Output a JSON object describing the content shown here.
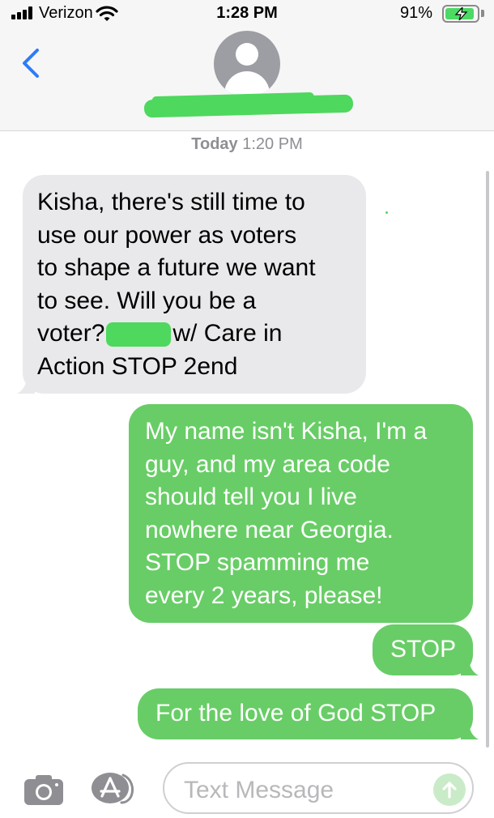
{
  "status_bar": {
    "carrier": "Verizon",
    "time": "1:28 PM",
    "battery_percent": "91%",
    "battery_level": 0.91,
    "signal_icon": "signal-bars-icon",
    "wifi_icon": "wifi-icon",
    "battery_icon": "battery-charging-icon"
  },
  "header": {
    "back_icon": "chevron-left-icon",
    "avatar_icon": "person-silhouette-icon",
    "contact_name_redacted": true
  },
  "thread": {
    "timestamp_day": "Today",
    "timestamp_time": "1:20 PM",
    "messages": [
      {
        "direction": "incoming",
        "lines": [
          "Kisha, there's still time to",
          "use our power as voters",
          "to shape a future we want",
          "to see. Will you be a"
        ],
        "line5_before": "voter?",
        "line5_after": "w/ Care in",
        "line6": "Action STOP 2end"
      },
      {
        "direction": "outgoing",
        "lines": [
          "My name isn't Kisha, I'm a",
          "guy, and my area code",
          "should tell you I live",
          "nowhere near Georgia.",
          "STOP spamming me",
          "every 2 years, please!"
        ]
      },
      {
        "direction": "outgoing",
        "text": "STOP"
      },
      {
        "direction": "outgoing",
        "text": "For the love of God STOP"
      }
    ]
  },
  "input_bar": {
    "camera_icon": "camera-icon",
    "apps_icon": "app-store-icon",
    "placeholder": "Text Message",
    "send_icon": "send-arrow-up-icon"
  },
  "colors": {
    "incoming_bubble": "#e9e9eb",
    "outgoing_bubble": "#68cd66",
    "ios_blue": "#2e7cf6",
    "timestamp_gray": "#8e8e93",
    "redaction_green": "#4ed85e"
  }
}
